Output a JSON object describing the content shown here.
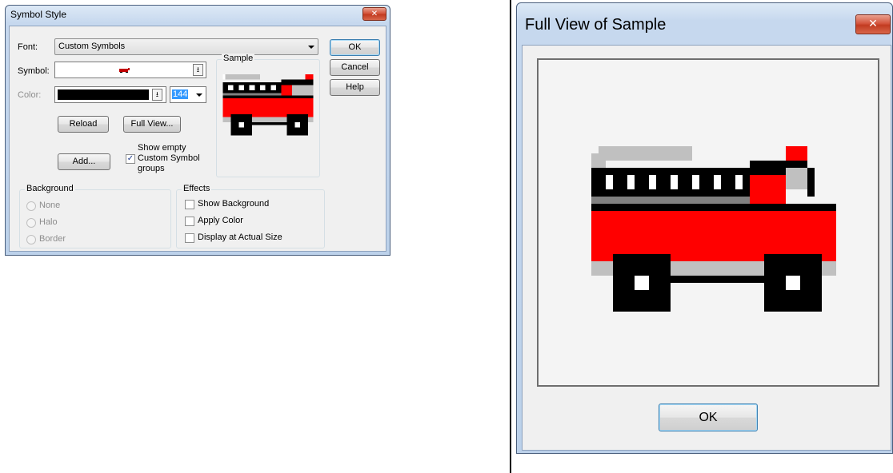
{
  "dialog": {
    "title": "Symbol Style",
    "close_glyph": "✕",
    "font_label": "Font:",
    "font_value": "Custom Symbols",
    "symbol_label": "Symbol:",
    "color_label": "Color:",
    "color_swatch": "#000000",
    "size_value": "144",
    "sample_label": "Sample",
    "buttons": {
      "ok": "OK",
      "cancel": "Cancel",
      "help": "Help",
      "reload": "Reload",
      "full_view": "Full View...",
      "add": "Add..."
    },
    "show_empty": {
      "label_line1": "Show empty",
      "label_line2": "Custom Symbol",
      "label_line3": "groups",
      "checked": true
    },
    "background": {
      "title": "Background",
      "options": [
        "None",
        "Halo",
        "Border"
      ]
    },
    "effects": {
      "title": "Effects",
      "options": [
        {
          "label": "Show Background",
          "checked": false
        },
        {
          "label": "Apply Color",
          "checked": false
        },
        {
          "label": "Display at Actual Size",
          "checked": false
        }
      ]
    }
  },
  "full_view": {
    "title": "Full View of Sample",
    "close_glyph": "✕",
    "ok_label": "OK"
  },
  "symbol": {
    "name": "fire-truck",
    "colors": {
      "red": "#ff0000",
      "black": "#000000",
      "light_gray": "#c0c0c0",
      "gray": "#808080",
      "white": "#ffffff"
    }
  }
}
